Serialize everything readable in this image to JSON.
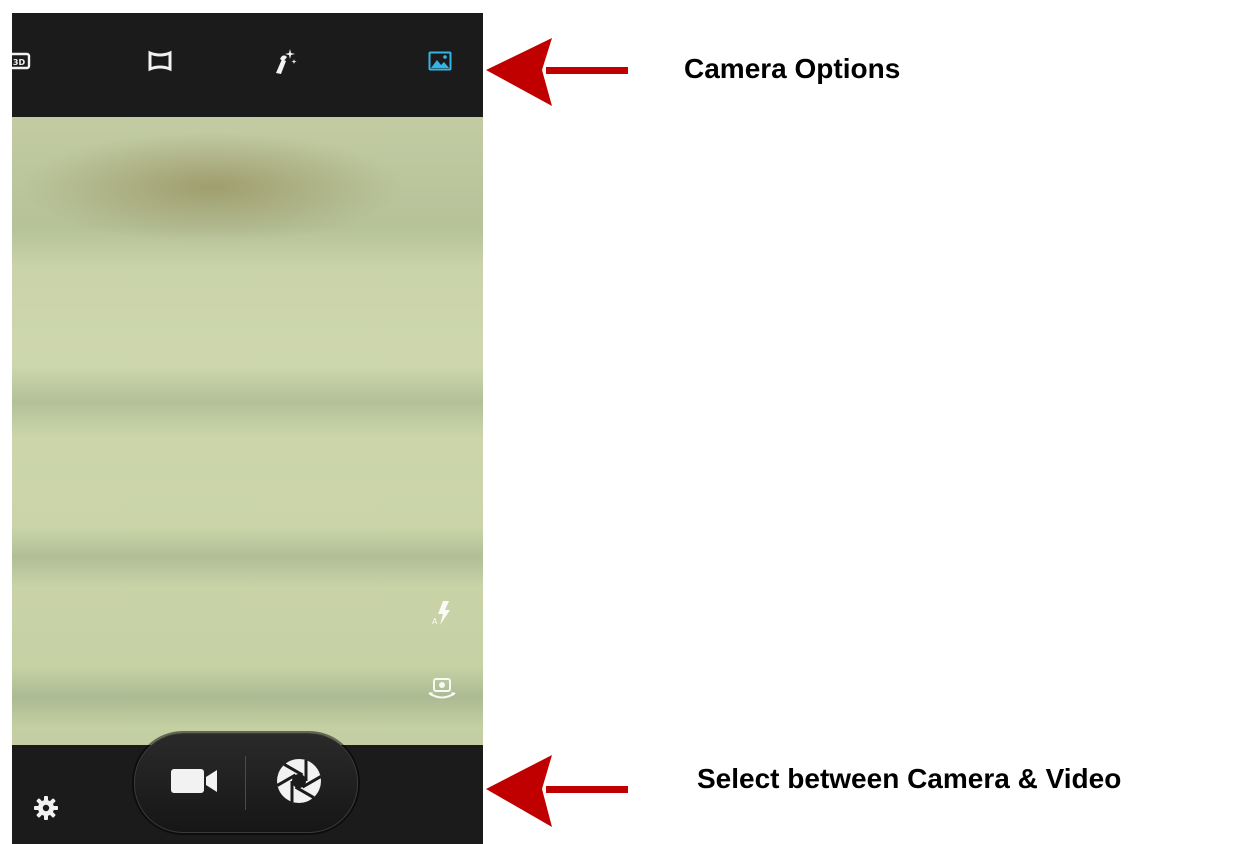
{
  "phone": {
    "top_modes": [
      {
        "name": "3d-mode-icon",
        "active": false
      },
      {
        "name": "panorama-icon",
        "active": false
      },
      {
        "name": "effects-wand-icon",
        "active": false
      },
      {
        "name": "photo-mode-icon",
        "active": true
      }
    ],
    "side_controls": [
      {
        "name": "auto-flash-icon"
      },
      {
        "name": "switch-camera-icon"
      }
    ],
    "bottom": {
      "settings": "gear-icon",
      "video": "video-camera-icon",
      "shutter": "shutter-aperture-icon"
    }
  },
  "annotations": {
    "top": "Camera Options",
    "bottom": "Select between Camera & Video"
  },
  "colors": {
    "bar": "#1b1b1b",
    "active_icon": "#33b5e5",
    "arrow": "#c00000"
  }
}
